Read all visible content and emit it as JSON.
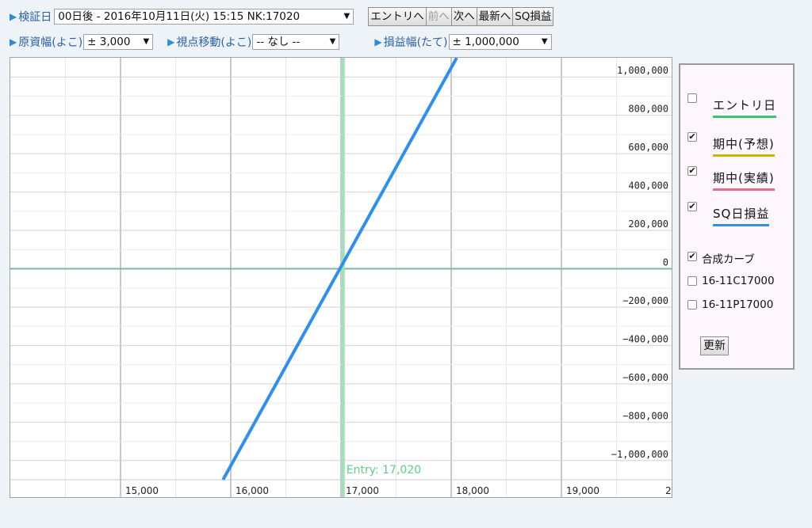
{
  "toolbar": {
    "date_label": "検証日",
    "date_value": "00日後 - 2016年10月11日(火) 15:15 NK:17020",
    "buttons": [
      {
        "label": "エントリへ",
        "disabled": false
      },
      {
        "label": "前へ",
        "disabled": true
      },
      {
        "label": "次へ",
        "disabled": false
      },
      {
        "label": "最新へ",
        "disabled": false
      },
      {
        "label": "SQ損益",
        "disabled": false
      }
    ],
    "underlying_label": "原資幅(よこ)",
    "underlying_value": "± 3,000",
    "viewpoint_label": "視点移動(よこ)",
    "viewpoint_value": "-- なし --",
    "pl_label": "損益幅(たて)",
    "pl_value": "± 1,000,000"
  },
  "legend": {
    "items": [
      {
        "label": "エントリ日",
        "checked": false,
        "color": "#3ec46d"
      },
      {
        "label": "期中(予想)",
        "checked": true,
        "color": "#c9b800"
      },
      {
        "label": "期中(実績)",
        "checked": true,
        "color": "#e0708a"
      },
      {
        "label": "SQ日損益",
        "checked": true,
        "color": "#2e8ff0"
      }
    ],
    "options": [
      {
        "label": "合成カーブ",
        "checked": true
      },
      {
        "label": "16-11C17000",
        "checked": false
      },
      {
        "label": "16-11P17000",
        "checked": false
      }
    ],
    "update_label": "更新"
  },
  "chart_data": {
    "type": "line",
    "xlim": [
      14000,
      20000
    ],
    "ylim": [
      -1100000,
      1100000
    ],
    "x_ticks": [
      15000,
      16000,
      17000,
      18000,
      19000
    ],
    "x_tick_labels": [
      "15,000",
      "16,000",
      "17,000",
      "18,000",
      "19,000",
      "2"
    ],
    "y_ticks": [
      1000000,
      800000,
      600000,
      400000,
      200000,
      0,
      -200000,
      -400000,
      -600000,
      -800000,
      -1000000
    ],
    "y_tick_labels": [
      "1,000,000",
      "800,000",
      "600,000",
      "400,000",
      "200,000",
      "0",
      "−200,000",
      "−400,000",
      "−600,000",
      "−800,000",
      "−1,000,000"
    ],
    "entry_x": 17020,
    "entry_label": "Entry: 17,020",
    "series": [
      {
        "name": "SQ日損益",
        "color": "#2e8ff0",
        "x": [
          15930,
          18050
        ],
        "y": [
          -1100000,
          1100000
        ]
      }
    ]
  }
}
